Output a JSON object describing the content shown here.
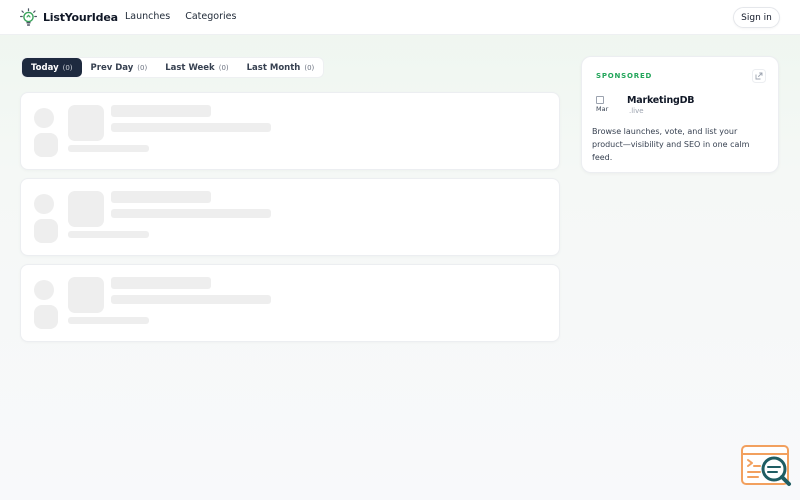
{
  "header": {
    "brand": "ListYourIdea",
    "nav": [
      {
        "label": "Launches"
      },
      {
        "label": "Categories"
      }
    ],
    "signin_label": "Sign in"
  },
  "tabs": [
    {
      "label": "Today",
      "count": "(0)",
      "active": true
    },
    {
      "label": "Prev Day",
      "count": "(0)",
      "active": false
    },
    {
      "label": "Last Week",
      "count": "(0)",
      "active": false
    },
    {
      "label": "Last Month",
      "count": "(0)",
      "active": false
    }
  ],
  "feed": {
    "loading_cards": 3
  },
  "sponsored": {
    "label": "SPONSORED",
    "image_alt": "Mar",
    "name": "MarketingDB",
    "domain": ".live",
    "description": "Browse launches, vote, and list your product—visibility and SEO in one calm feed.",
    "external_icon": "external-link-icon"
  },
  "icons": {
    "logo": "lightbulb-icon",
    "widget": "search-feedback-icon"
  },
  "colors": {
    "active_tab": "#1e2a3f",
    "sponsored_label": "#22a55a",
    "brand_green": "#3aa35b",
    "widget_orange": "#f2a05e",
    "widget_teal": "#1f5d63"
  }
}
